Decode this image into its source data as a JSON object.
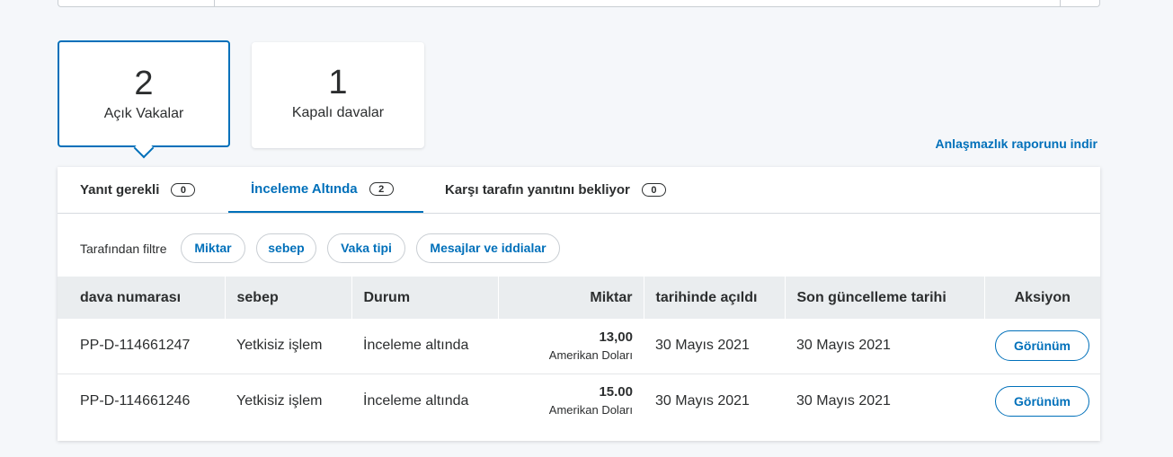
{
  "summary_cards": [
    {
      "count": "2",
      "label": "Açık Vakalar"
    },
    {
      "count": "1",
      "label": "Kapalı davalar"
    }
  ],
  "report_link": "Anlaşmazlık raporunu indir",
  "tabs": [
    {
      "label": "Yanıt gerekli",
      "count": "0"
    },
    {
      "label": "İnceleme Altında",
      "count": "2"
    },
    {
      "label": "Karşı tarafın yanıtını bekliyor",
      "count": "0"
    }
  ],
  "filter": {
    "label": "Tarafından filtre",
    "chips": [
      "Miktar",
      "sebep",
      "Vaka tipi",
      "Mesajlar ve iddialar"
    ]
  },
  "table": {
    "headers": [
      "dava numarası",
      "sebep",
      "Durum",
      "Miktar",
      "tarihinde açıldı",
      "Son güncelleme tarihi",
      "Aksiyon"
    ],
    "rows": [
      {
        "case_no": "PP-D-114661247",
        "reason": "Yetkisiz işlem",
        "status": "İnceleme altında",
        "amount": "13,00",
        "currency": "Amerikan Doları",
        "opened": "30 Mayıs 2021",
        "updated": "30 Mayıs 2021",
        "action": "Görünüm"
      },
      {
        "case_no": "PP-D-114661246",
        "reason": "Yetkisiz işlem",
        "status": "İnceleme altında",
        "amount": "15.00",
        "currency": "Amerikan Doları",
        "opened": "30 Mayıs 2021",
        "updated": "30 Mayıs 2021",
        "action": "Görünüm"
      }
    ]
  },
  "colors": {
    "accent": "#0070ba",
    "header_bg": "#eaedef",
    "page_bg": "#f5f7fa"
  }
}
